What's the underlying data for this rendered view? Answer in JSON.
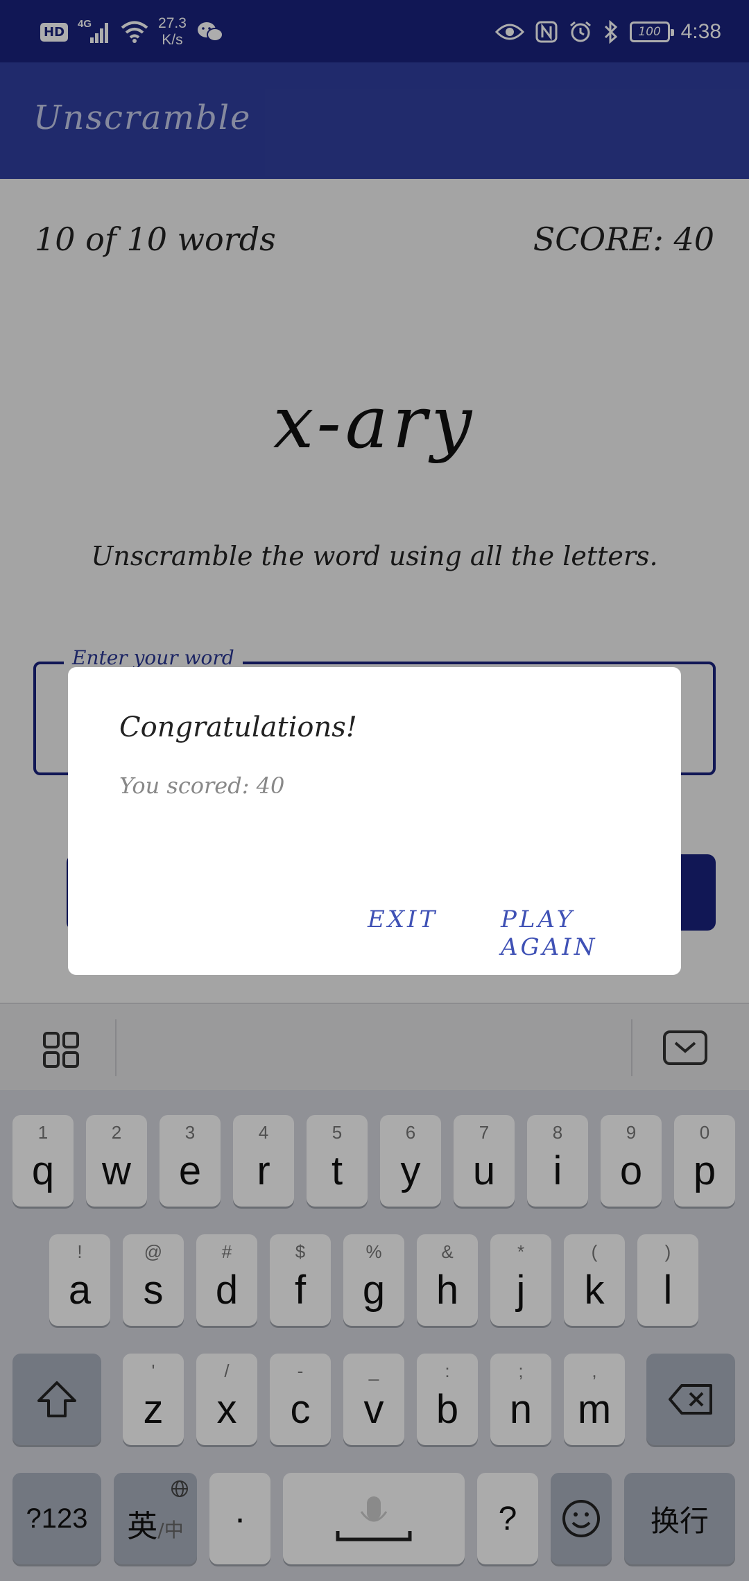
{
  "status_bar": {
    "hd_label": "HD",
    "network_label": "4G",
    "speed_value": "27.3",
    "speed_unit": "K/s",
    "battery_level": "100",
    "time": "4:38",
    "icons": [
      "signal-icon",
      "wifi-icon",
      "wechat-icon",
      "eye-icon",
      "nfc-icon",
      "alarm-icon",
      "bluetooth-icon",
      "battery-icon"
    ]
  },
  "app_bar": {
    "title": "Unscramble"
  },
  "game": {
    "word_count": "10 of 10 words",
    "score": "SCORE: 40",
    "scrambled_word": "x-ary",
    "instructions": "Unscramble the word using all the letters.",
    "input_label": "Enter your word",
    "input_value": ""
  },
  "dialog": {
    "title": "Congratulations!",
    "message": "You scored: 40",
    "exit_label": "EXIT",
    "play_again_label": "PLAY AGAIN"
  },
  "keyboard": {
    "row1": [
      {
        "sup": "1",
        "key": "q"
      },
      {
        "sup": "2",
        "key": "w"
      },
      {
        "sup": "3",
        "key": "e"
      },
      {
        "sup": "4",
        "key": "r"
      },
      {
        "sup": "5",
        "key": "t"
      },
      {
        "sup": "6",
        "key": "y"
      },
      {
        "sup": "7",
        "key": "u"
      },
      {
        "sup": "8",
        "key": "i"
      },
      {
        "sup": "9",
        "key": "o"
      },
      {
        "sup": "0",
        "key": "p"
      }
    ],
    "row2": [
      {
        "sup": "!",
        "key": "a"
      },
      {
        "sup": "@",
        "key": "s"
      },
      {
        "sup": "#",
        "key": "d"
      },
      {
        "sup": "$",
        "key": "f"
      },
      {
        "sup": "%",
        "key": "g"
      },
      {
        "sup": "&",
        "key": "h"
      },
      {
        "sup": "*",
        "key": "j"
      },
      {
        "sup": "(",
        "key": "k"
      },
      {
        "sup": ")",
        "key": "l"
      }
    ],
    "row3": [
      {
        "sup": "'",
        "key": "z"
      },
      {
        "sup": "/",
        "key": "x"
      },
      {
        "sup": "-",
        "key": "c"
      },
      {
        "sup": "_",
        "key": "v"
      },
      {
        "sup": ":",
        "key": "b"
      },
      {
        "sup": ";",
        "key": "n"
      },
      {
        "sup": ",",
        "key": "m"
      }
    ],
    "symbols_label": "?123",
    "lang_label": "英",
    "lang_alt_label": "/中",
    "period_label": "·",
    "question_label": "?",
    "enter_label": "换行"
  }
}
